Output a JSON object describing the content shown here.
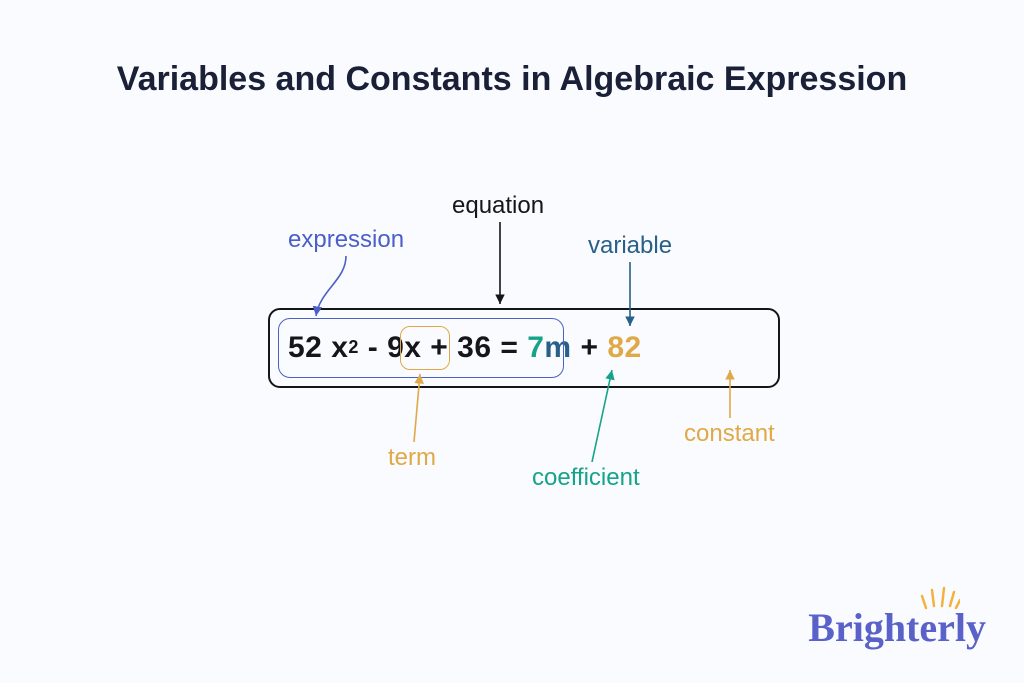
{
  "title": "Variables and Constants in Algebraic Expression",
  "labels": {
    "expression": "expression",
    "equation": "equation",
    "variable": "variable",
    "term": "term",
    "coefficient": "coefficient",
    "constant": "constant"
  },
  "equation": {
    "t1": "52 x",
    "sup": "2",
    "minus": " - ",
    "t2": "9x",
    "plus1": " + ",
    "t3": "36",
    "eq": " = ",
    "coef": "7",
    "var": "m",
    "plus2": " + ",
    "const": "82"
  },
  "brand": "Brighterly",
  "colors": {
    "purple": "#4B5FC8",
    "black": "#14161A",
    "navy": "#276089",
    "teal": "#16A38A",
    "orange": "#E0A947"
  }
}
